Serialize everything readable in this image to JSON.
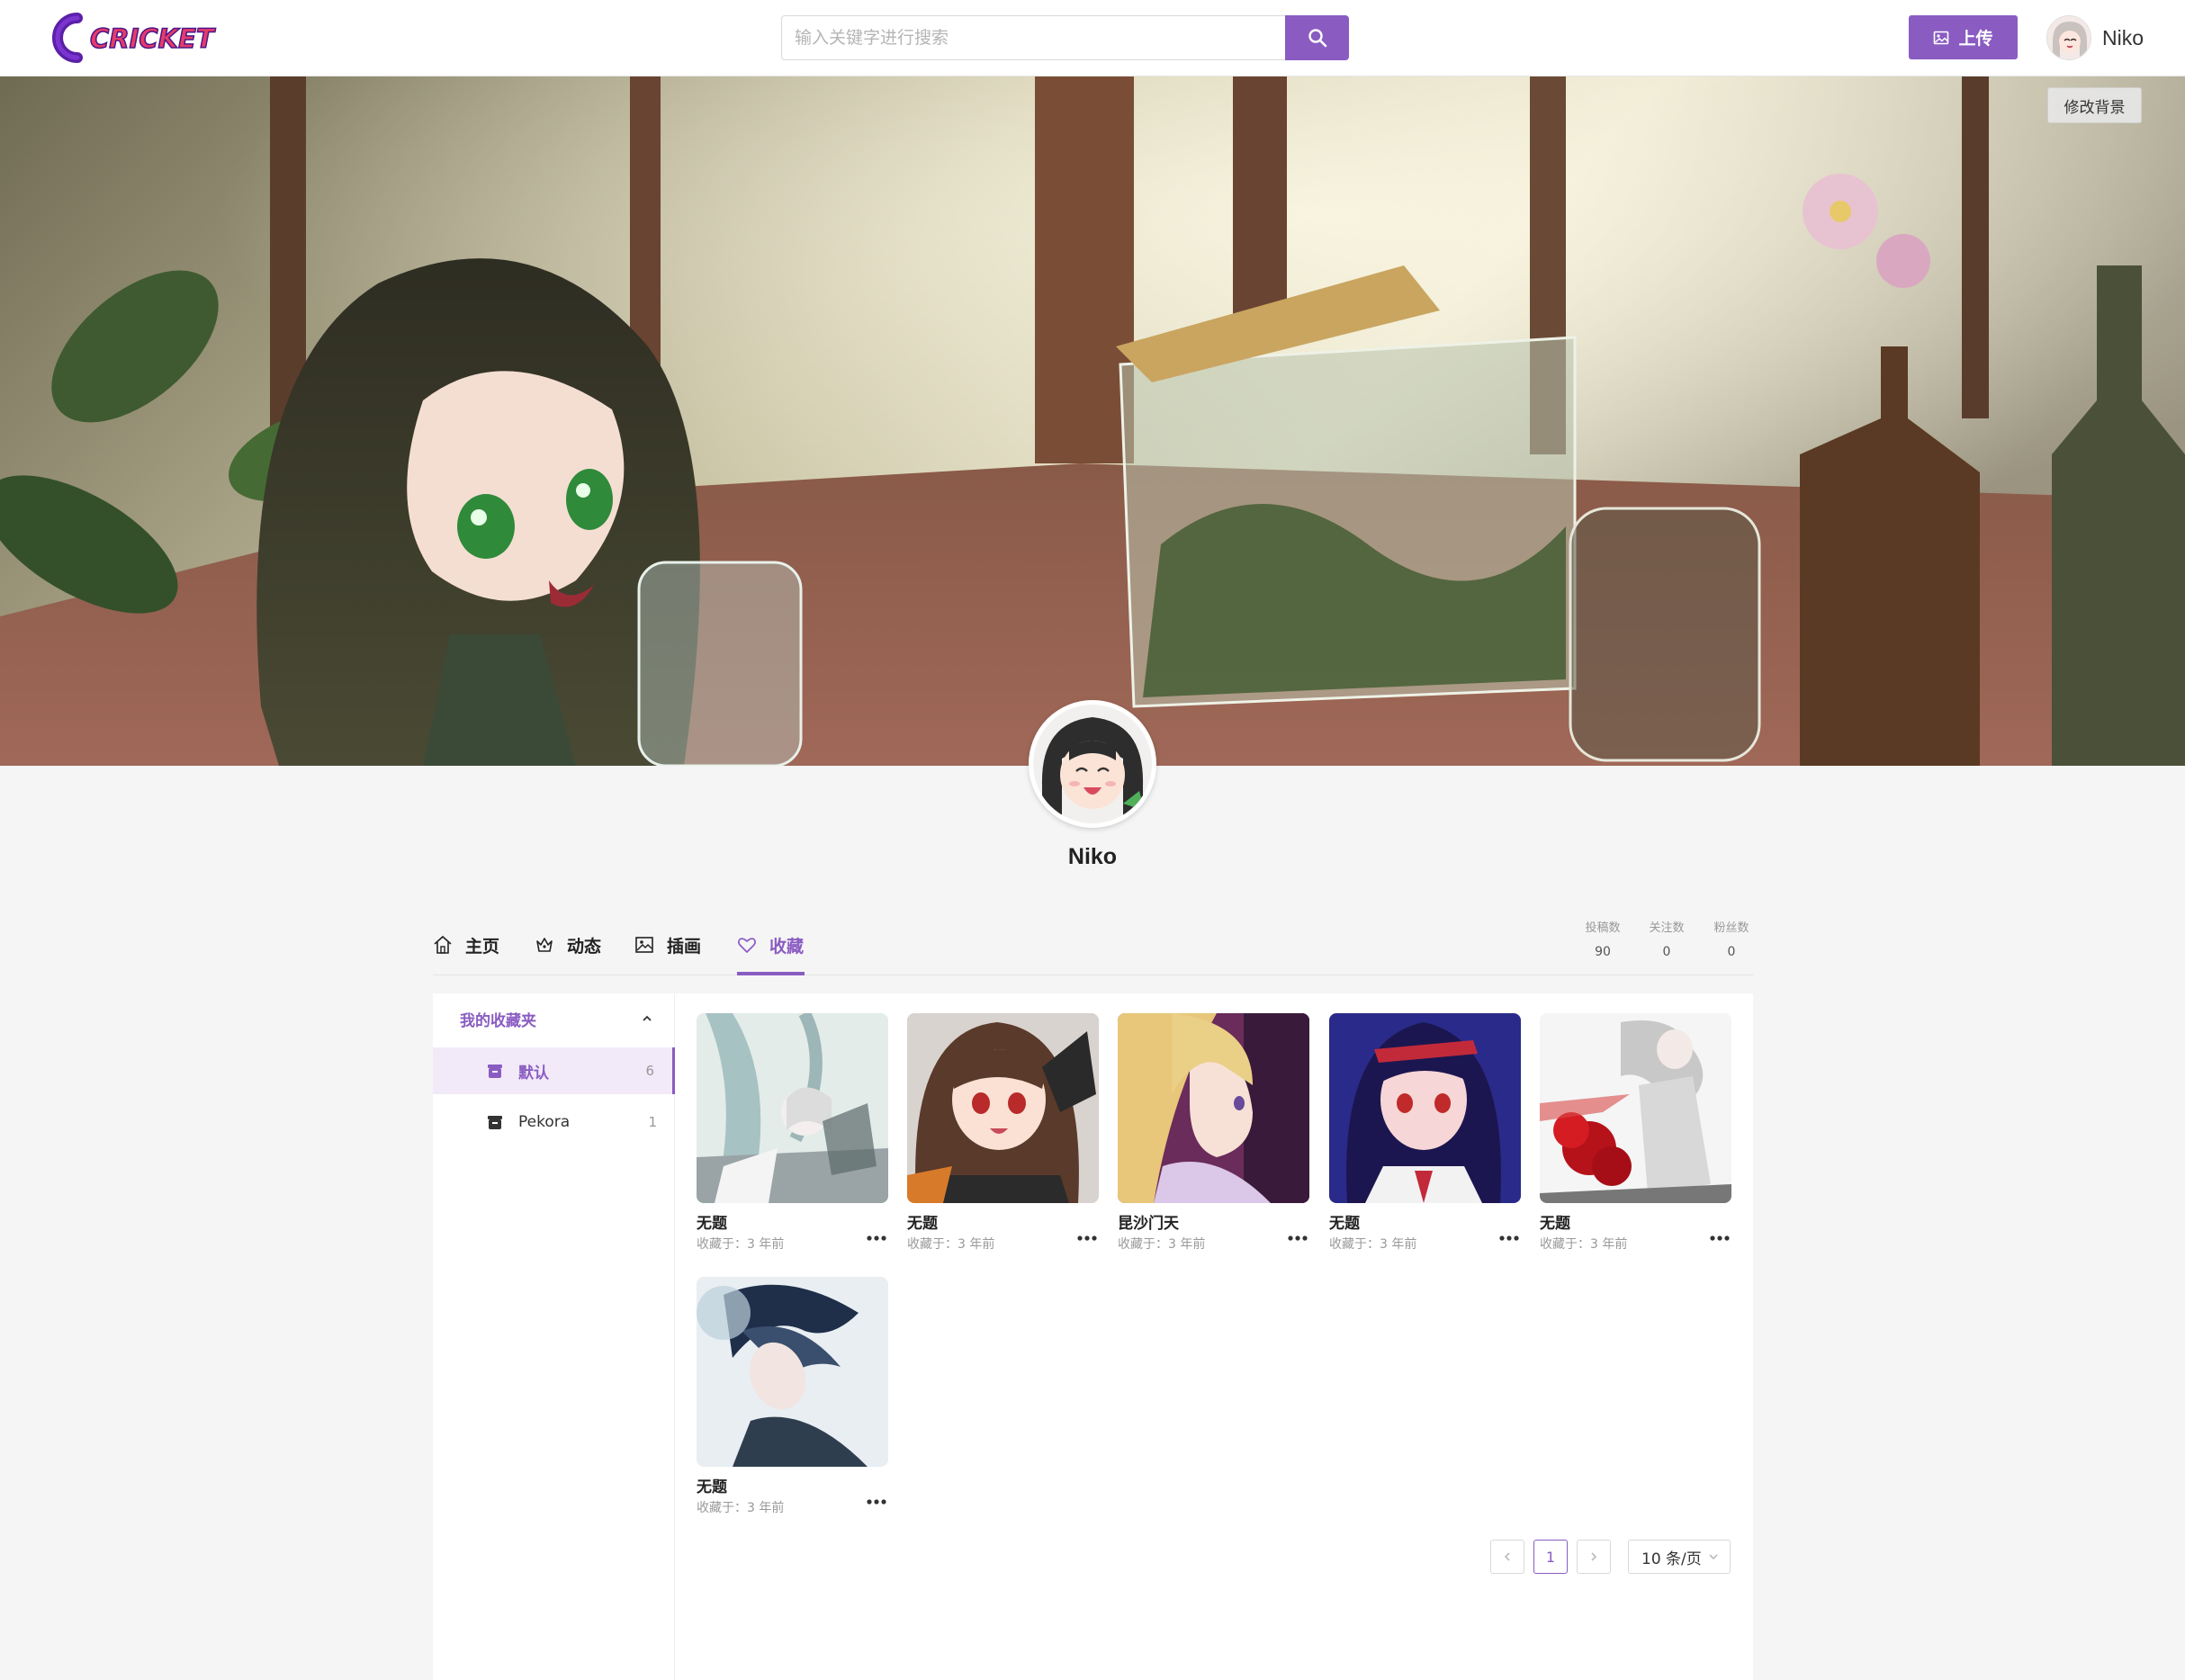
{
  "brand": {
    "logo_text": "CRICKET",
    "accent_color": "#8a5cc2"
  },
  "search": {
    "placeholder": "输入关键字进行搜索"
  },
  "header": {
    "upload_label": "上传",
    "username": "Niko"
  },
  "banner": {
    "change_background_label": "修改背景"
  },
  "profile": {
    "name": "Niko"
  },
  "tabs": [
    {
      "label": "主页",
      "icon": "home-icon"
    },
    {
      "label": "动态",
      "icon": "activity-icon"
    },
    {
      "label": "插画",
      "icon": "image-icon"
    },
    {
      "label": "收藏",
      "icon": "heart-icon",
      "active": true
    }
  ],
  "stats": [
    {
      "label": "投稿数",
      "value": "90"
    },
    {
      "label": "关注数",
      "value": "0"
    },
    {
      "label": "粉丝数",
      "value": "0"
    }
  ],
  "folders": {
    "title": "我的收藏夹",
    "items": [
      {
        "label": "默认",
        "count": "6",
        "active": true
      },
      {
        "label": "Pekora",
        "count": "1"
      }
    ]
  },
  "favorites": [
    {
      "title": "无题",
      "meta": "收藏于：3 年前"
    },
    {
      "title": "无题",
      "meta": "收藏于：3 年前"
    },
    {
      "title": "昆沙门天",
      "meta": "收藏于：3 年前"
    },
    {
      "title": "无题",
      "meta": "收藏于：3 年前"
    },
    {
      "title": "无题",
      "meta": "收藏于：3 年前"
    },
    {
      "title": "无题",
      "meta": "收藏于：3 年前"
    }
  ],
  "pagination": {
    "current_page": "1",
    "page_size": "10 条/页"
  }
}
